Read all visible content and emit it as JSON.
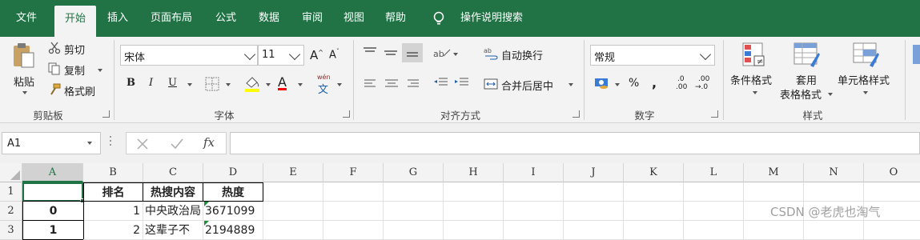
{
  "menu": {
    "tabs": [
      "文件",
      "开始",
      "插入",
      "页面布局",
      "公式",
      "数据",
      "审阅",
      "视图",
      "帮助"
    ],
    "active": "开始",
    "tell_me": "操作说明搜索"
  },
  "clipboard": {
    "paste": "粘贴",
    "cut": "剪切",
    "copy": "复制",
    "format_painter": "格式刷",
    "group_label": "剪贴板"
  },
  "font": {
    "name": "宋体",
    "size": "11",
    "grow": "A",
    "shrink": "A",
    "bold": "B",
    "italic": "I",
    "underline": "U",
    "font_color_glyph": "A",
    "phonetic_top": "wén",
    "phonetic_char": "文",
    "group_label": "字体"
  },
  "alignment": {
    "wrap_text": "自动换行",
    "merge_center": "合并后居中",
    "group_label": "对齐方式"
  },
  "number": {
    "format": "常规",
    "percent": "%",
    "comma": ",",
    "inc_decimal_top": ".0",
    "inc_decimal_bottom": ".00",
    "dec_decimal_top": ".00",
    "dec_decimal_bottom": "→.0",
    "group_label": "数字"
  },
  "styles": {
    "conditional": "条件格式",
    "table_top": "套用",
    "table_bottom": "表格格式",
    "cell_styles": "单元格样式",
    "group_label": "样式"
  },
  "formula_bar": {
    "name_box": "A1",
    "fx": "fx",
    "formula": ""
  },
  "sheet": {
    "columns": [
      "A",
      "B",
      "C",
      "D",
      "E",
      "F",
      "G",
      "H",
      "I",
      "J",
      "K",
      "L",
      "M",
      "N",
      "O"
    ],
    "rows": [
      {
        "num": "1",
        "A": "",
        "B": "排名",
        "C": "热搜内容",
        "D": "热度"
      },
      {
        "num": "2",
        "A": "0",
        "B": "1",
        "C": "中央政治局",
        "D": "3671099"
      },
      {
        "num": "3",
        "A": "1",
        "B": "2",
        "C": "这辈子不",
        "D": "2194889"
      }
    ],
    "selected_cell": "A1",
    "selected_column": "A"
  },
  "watermark": "CSDN @老虎也淘气",
  "colors": {
    "accent": "#217346",
    "ribbon_bg": "#f3f3f3",
    "highlight_yellow": "#ffff00",
    "font_red": "#ff0000"
  }
}
